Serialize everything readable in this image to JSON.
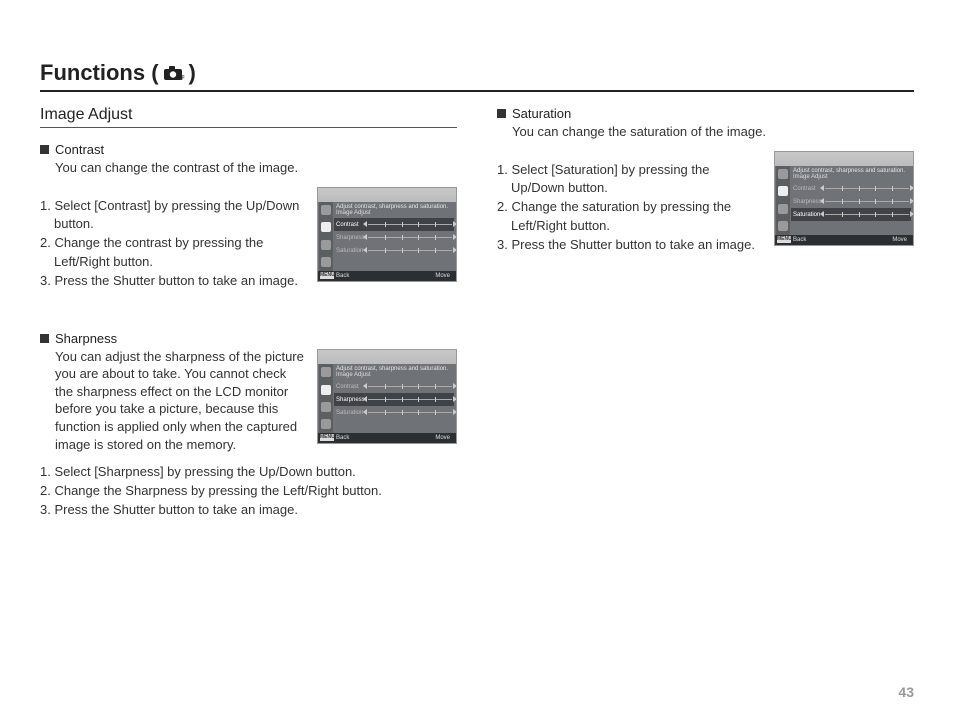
{
  "title_prefix": "Functions (",
  "title_suffix": ")",
  "page_number": "43",
  "left": {
    "heading": "Image Adjust",
    "contrast": {
      "name": "Contrast",
      "desc": "You can change the contrast of the image.",
      "steps": [
        "1. Select [Contrast] by pressing the Up/Down button.",
        "2. Change the contrast by pressing the Left/Right button.",
        "3. Press the Shutter button to take an image."
      ]
    },
    "sharpness": {
      "name": "Sharpness",
      "desc": "You can adjust the sharpness of the picture you are about to take. You cannot check the sharpness effect on the LCD monitor before you take a picture, because this function is applied only when the captured image is stored on the memory.",
      "steps": [
        "1. Select [Sharpness] by pressing the Up/Down button.",
        "2. Change the Sharpness by pressing the Left/Right button.",
        "3. Press the Shutter button to take an image."
      ]
    }
  },
  "right": {
    "saturation": {
      "name": "Saturation",
      "desc": "You can change the saturation of the image.",
      "steps": [
        "1. Select [Saturation] by pressing the Up/Down button.",
        "2. Change the saturation by pressing the Left/Right button.",
        "3. Press the Shutter button to take an image."
      ]
    }
  },
  "screenshot": {
    "desc_line": "Adjust contrast, sharpness and saturation.",
    "panel_label": "Image Adjust",
    "row_contrast": "Contrast",
    "row_sharpness": "Sharpness",
    "row_saturation": "Saturation",
    "footer_back": "Back",
    "footer_move": "Move",
    "menu_label": "MENU"
  }
}
